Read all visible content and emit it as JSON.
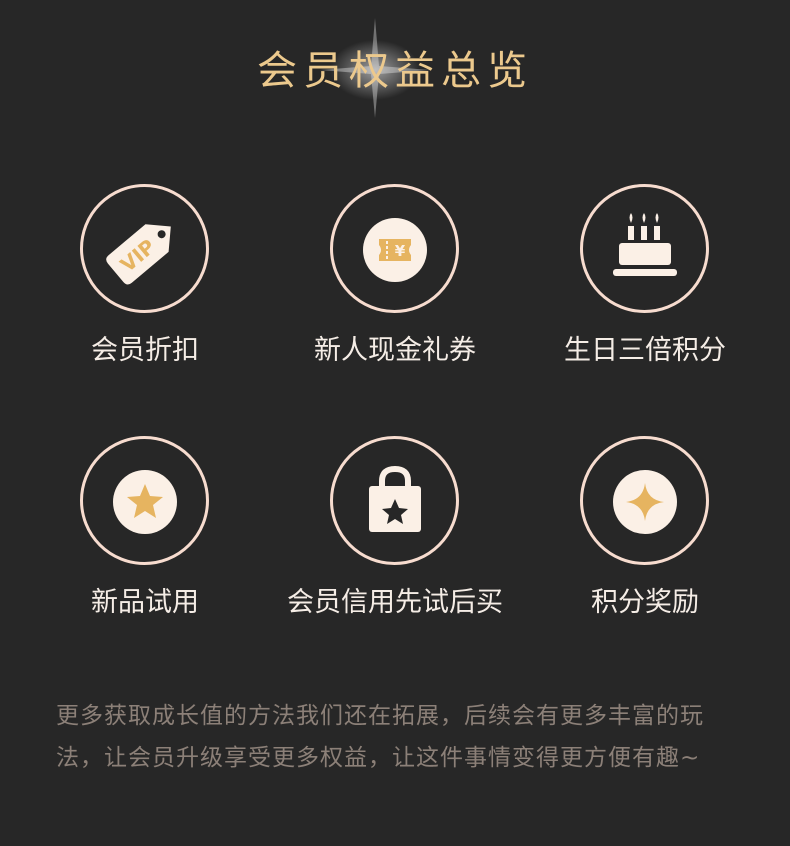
{
  "header": {
    "title": "会员权益总览"
  },
  "benefits": [
    {
      "label": "会员折扣",
      "icon": "vip-tag-icon"
    },
    {
      "label": "新人现金礼券",
      "icon": "yuan-coupon-icon"
    },
    {
      "label": "生日三倍积分",
      "icon": "birthday-cake-icon"
    },
    {
      "label": "新品试用",
      "icon": "star-icon"
    },
    {
      "label": "会员信用先试后买",
      "icon": "shopping-bag-star-icon"
    },
    {
      "label": "积分奖励",
      "icon": "sparkle-icon"
    }
  ],
  "icon_texts": {
    "vip": "VIP",
    "yuan": "¥"
  },
  "footer": {
    "text": "更多获取成长值的方法我们还在拓展，后续会有更多丰富的玩法，让会员升级享受更多权益，让这件事情变得更方便有趣~"
  },
  "colors": {
    "background": "#272727",
    "title": "#ecc98d",
    "ring": "#f7dccf",
    "gold": "#e6b460",
    "cream": "#fbf0e6"
  }
}
